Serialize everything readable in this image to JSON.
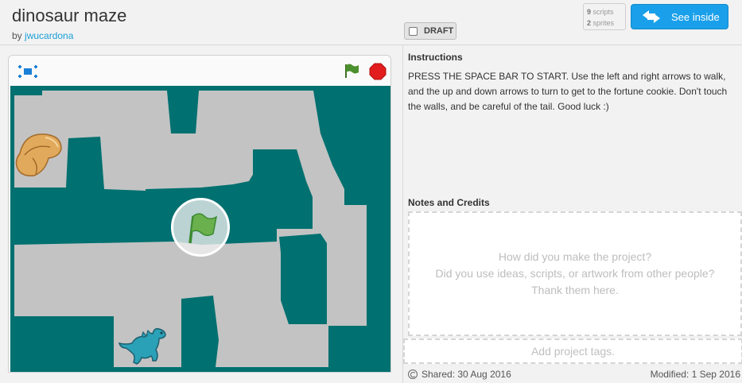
{
  "project": {
    "title": "dinosaur maze",
    "by_prefix": "by",
    "author": "jwucardona",
    "draft_label": "DRAFT"
  },
  "stats": {
    "scripts_count": "9",
    "scripts_label": "scripts",
    "sprites_count": "2",
    "sprites_label": "sprites"
  },
  "see_inside": {
    "label": "See inside"
  },
  "player": {
    "stage_colors": {
      "wall": "#007070",
      "path": "#c3c3c3"
    }
  },
  "instructions": {
    "heading": "Instructions",
    "text": "PRESS THE SPACE BAR TO START.  Use the left and right arrows to walk, and the up and down arrows to turn to get to the fortune cookie. Don't touch the walls, and be careful of the tail. Good luck :)"
  },
  "notes": {
    "heading": "Notes and Credits",
    "placeholder_lines": [
      "How did you make the project?",
      "Did you use ideas, scripts, or artwork from other people?",
      "Thank them here."
    ]
  },
  "tags": {
    "placeholder": "Add project tags."
  },
  "footer": {
    "shared": "Shared: 30 Aug 2016",
    "modified": "Modified: 1 Sep 2016"
  },
  "colors": {
    "accent": "#1aa0ea",
    "author_link": "#1aa0d8",
    "flag_green": "#4c8f2e",
    "stop_red": "#e21d1d"
  }
}
